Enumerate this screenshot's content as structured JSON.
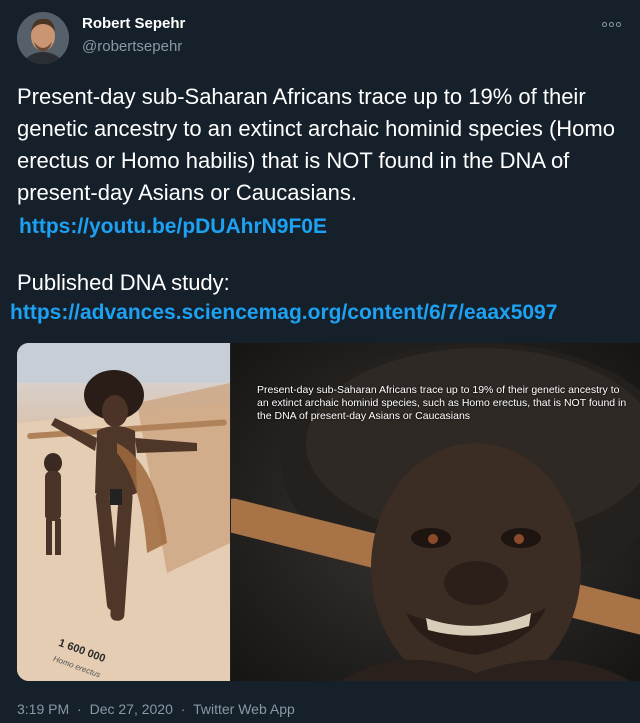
{
  "author": {
    "name": "Robert Sepehr",
    "handle": "@robertsepehr"
  },
  "tweet": {
    "text": "Present-day sub-Saharan Africans trace up to 19% of their genetic ancestry to an extinct archaic hominid species (Homo erectus or Homo habilis) that is NOT found in the DNA of present-day Asians or Caucasians.",
    "link1": "https://youtu.be/pDUAhrN9F0E",
    "study_label": "Published DNA study:",
    "link2": "https://advances.sciencemag.org/content/6/7/eaax5097"
  },
  "media": {
    "caption": "Present-day sub-Saharan Africans trace up to 19% of their genetic ancestry to an extinct archaic hominid species, such as Homo erectus, that is NOT found in the DNA of present-day Asians or Caucasians",
    "exhibit_label": "1 600 000",
    "exhibit_sub": "Homo erectus"
  },
  "meta": {
    "time": "3:19 PM",
    "separator": "·",
    "date": "Dec 27, 2020",
    "app": "Twitter Web App"
  },
  "icons": {
    "more": "more-options-icon"
  },
  "colors": {
    "background": "#15202b",
    "link": "#1da1f2",
    "secondary_text": "#8899a6"
  }
}
